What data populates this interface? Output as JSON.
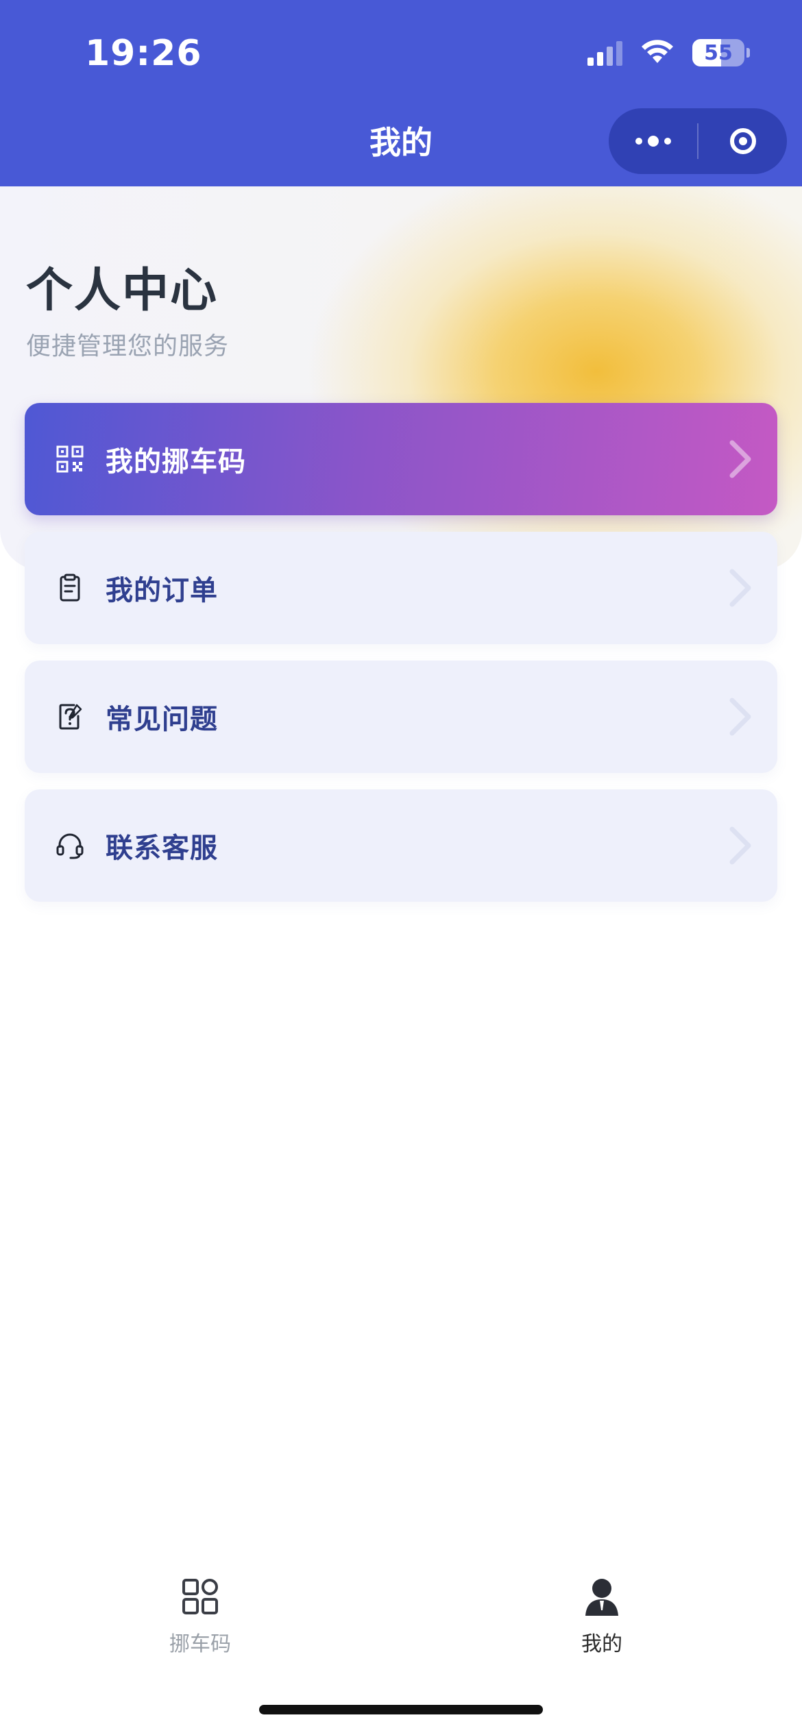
{
  "status_bar": {
    "time": "19:26",
    "battery": "55",
    "battery_level": 0.55
  },
  "nav": {
    "title": "我的"
  },
  "hero": {
    "title": "个人中心",
    "subtitle": "便捷管理您的服务"
  },
  "menu": [
    {
      "label": "我的挪车码",
      "icon": "qr-code-icon"
    },
    {
      "label": "我的订单",
      "icon": "clipboard-icon"
    },
    {
      "label": "常见问题",
      "icon": "question-note-icon"
    },
    {
      "label": "联系客服",
      "icon": "headset-icon"
    }
  ],
  "tabbar": {
    "items": [
      {
        "label": "挪车码",
        "icon": "grid-apps-icon",
        "active": false
      },
      {
        "label": "我的",
        "icon": "person-icon",
        "active": true
      }
    ]
  },
  "colors": {
    "header": "#4859d6",
    "accent_start": "#4f58d4",
    "accent_end": "#c459c4",
    "menu_text": "#2f3f8f",
    "hero_glow": "#f2be3c"
  }
}
